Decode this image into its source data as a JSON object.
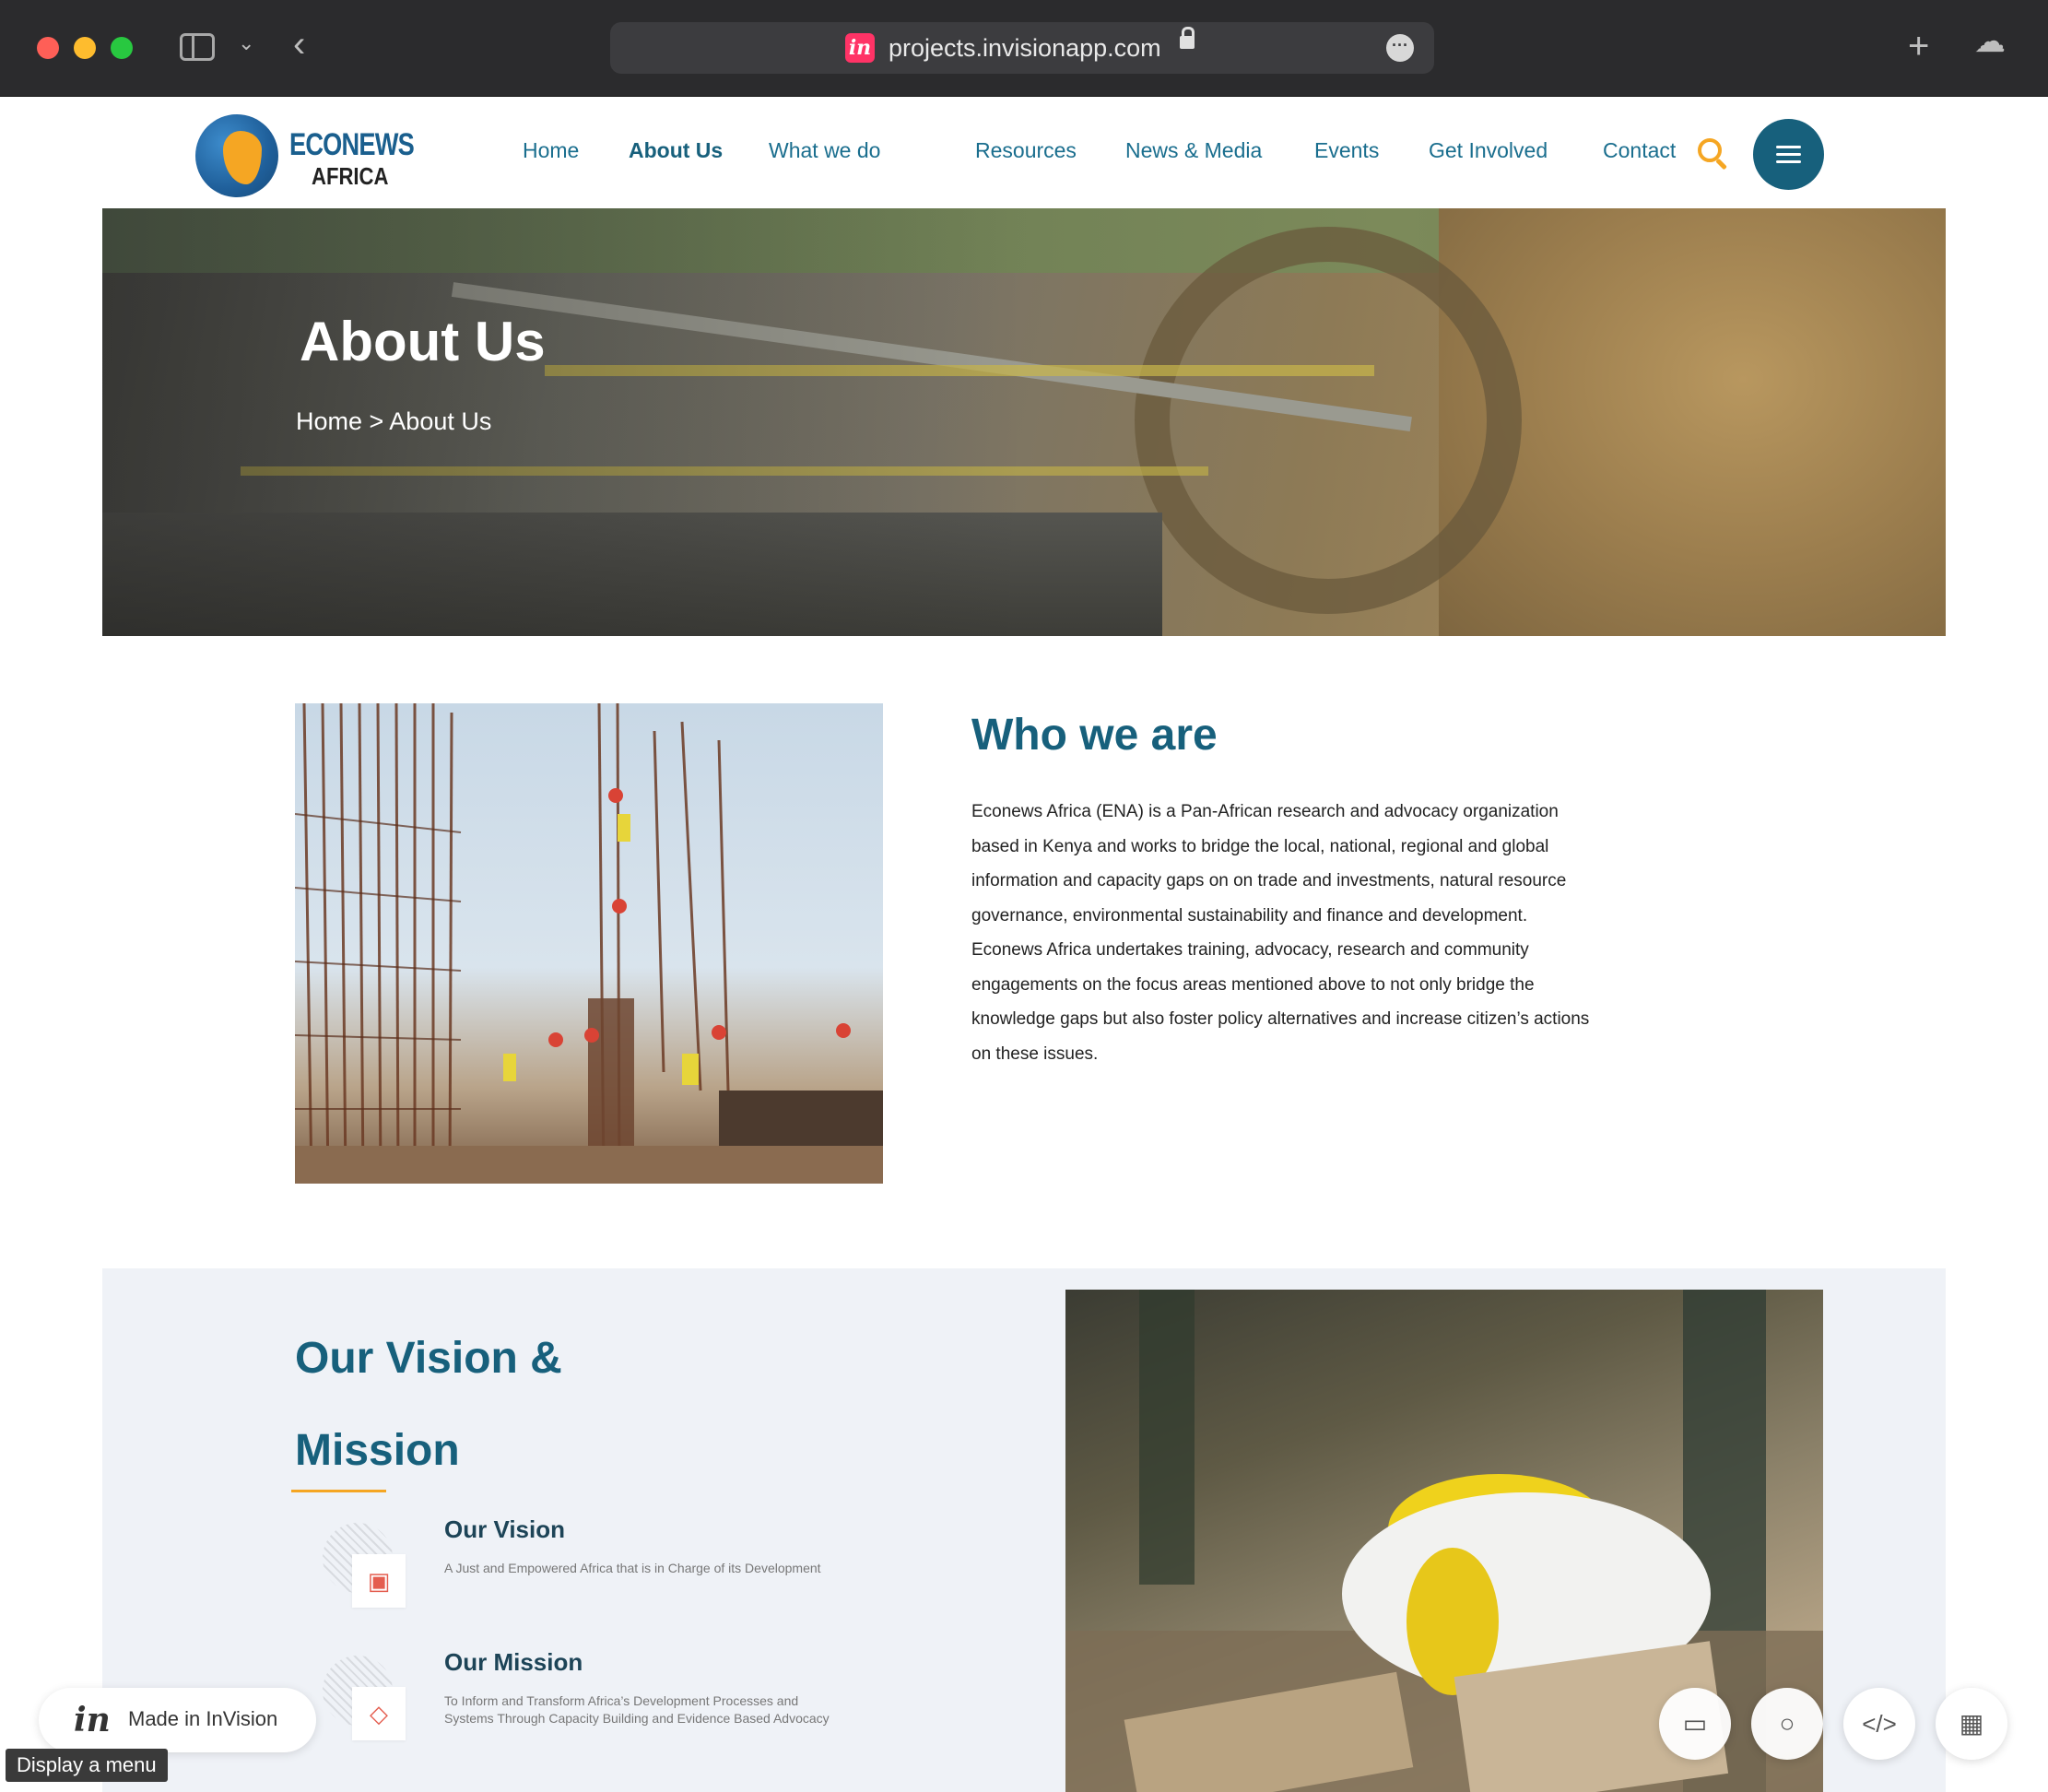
{
  "browser": {
    "url": "projects.invisionapp.com",
    "favicon_letter": "in"
  },
  "logo": {
    "line1": "ECONEWS",
    "line2": "AFRICA"
  },
  "nav": {
    "items": [
      "Home",
      "About Us",
      "What we do",
      "Resources",
      "News & Media",
      "Events",
      "Get Involved",
      "Contact"
    ],
    "active": "About Us"
  },
  "hero": {
    "title": "About Us",
    "breadcrumb": "Home > About Us"
  },
  "who": {
    "title": "Who we are",
    "lines": [
      "Econews Africa (ENA) is a Pan-African research and advocacy organization",
      "based in Kenya and works to bridge the local, national, regional and global",
      "information and capacity gaps on  on trade and investments, natural resource",
      "governance,  environmental sustainability and finance and development.",
      "Econews Africa undertakes training, advocacy, research and community",
      "engagements on the focus areas mentioned above  to not only bridge the",
      "knowledge gaps but also foster policy alternatives and increase citizen’s actions",
      "on these issues."
    ]
  },
  "vision_mission": {
    "title_line1": "Our Vision &",
    "title_line2": "Mission",
    "vision_heading": "Our Vision",
    "vision_text": "A Just and Empowered Africa that is in Charge of its Development",
    "mission_heading": "Our Mission",
    "mission_text_line1": "To Inform and Transform Africa’s Development Processes and",
    "mission_text_line2": "Systems Through Capacity Building and Evidence Based Advocacy"
  },
  "invision": {
    "made_in": "Made in InVision",
    "tooltip": "Display a menu"
  },
  "colors": {
    "brand_teal": "#17607c",
    "accent_orange": "#f5a623",
    "section_bg": "#eff2f7"
  },
  "icons": {
    "vision": "vision-icon",
    "mission": "diamond-icon"
  }
}
